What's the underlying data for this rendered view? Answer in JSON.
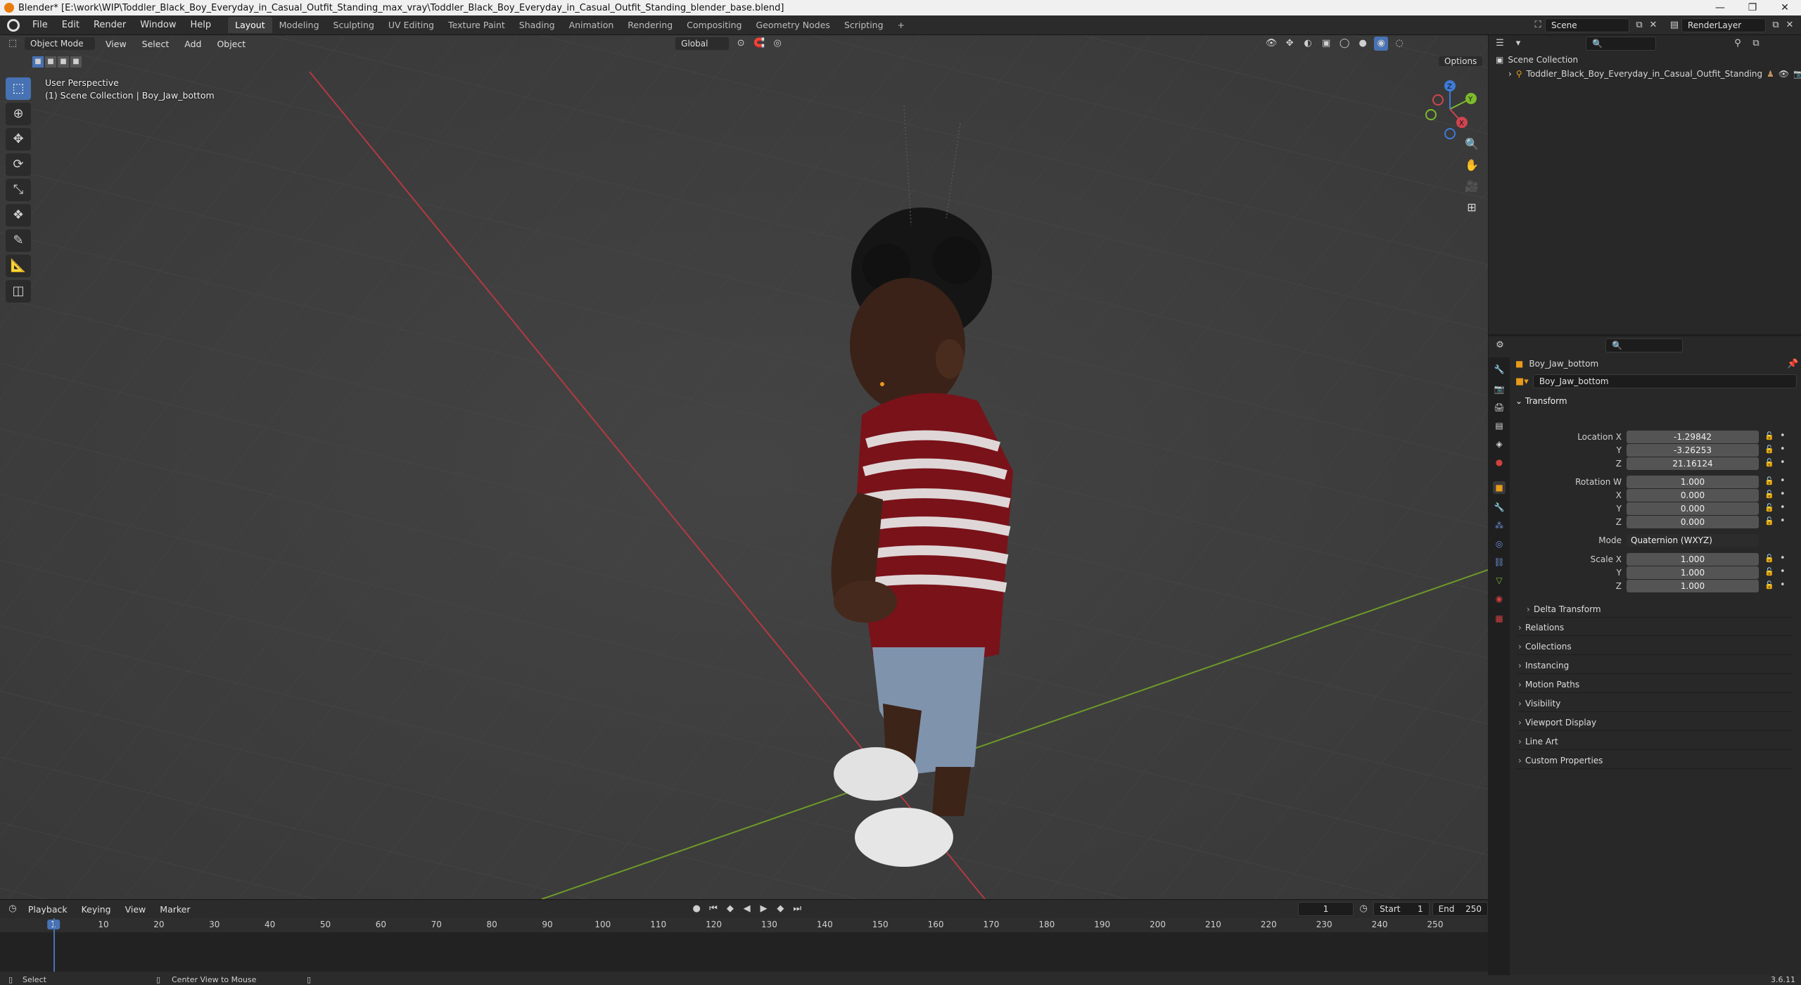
{
  "window": {
    "title": "Blender* [E:\\work\\WIP\\Toddler_Black_Boy_Everyday_in_Casual_Outfit_Standing_max_vray\\Toddler_Black_Boy_Everyday_in_Casual_Outfit_Standing_blender_base.blend]",
    "minimize": "—",
    "maximize": "❐",
    "close": "✕"
  },
  "topbar": {
    "menus": [
      "File",
      "Edit",
      "Render",
      "Window",
      "Help"
    ],
    "workspaces": [
      "Layout",
      "Modeling",
      "Sculpting",
      "UV Editing",
      "Texture Paint",
      "Shading",
      "Animation",
      "Rendering",
      "Compositing",
      "Geometry Nodes",
      "Scripting"
    ],
    "active_workspace": "Layout",
    "add_tab": "+",
    "scene": "Scene",
    "render_layer": "RenderLayer"
  },
  "viewport": {
    "mode": "Object Mode",
    "menus": [
      "View",
      "Select",
      "Add",
      "Object"
    ],
    "orientation": "Global",
    "options": "Options",
    "view_name": "User Perspective",
    "collection_info": "(1) Scene Collection | Boy_Jaw_bottom",
    "gizmo": {
      "x": "X",
      "y": "Y",
      "z": "Z"
    }
  },
  "outliner": {
    "root": "Scene Collection",
    "items": [
      "Toddler_Black_Boy_Everyday_in_Casual_Outfit_Standing"
    ]
  },
  "properties": {
    "object_name": "Boy_Jaw_bottom",
    "data_name": "Boy_Jaw_bottom",
    "transform_label": "Transform",
    "location_label": "Location X",
    "location": [
      "-1.29842",
      "-3.26253",
      "21.16124"
    ],
    "rotation_label": "Rotation W",
    "rotation": [
      "1.000",
      "0.000",
      "0.000",
      "0.000"
    ],
    "mode_label": "Mode",
    "mode_value": "Quaternion (WXYZ)",
    "scale_label": "Scale X",
    "scale": [
      "1.000",
      "1.000",
      "1.000"
    ],
    "axis_labels": [
      "Y",
      "Z",
      "X"
    ],
    "panels": [
      "Delta Transform",
      "Relations",
      "Collections",
      "Instancing",
      "Motion Paths",
      "Visibility",
      "Viewport Display",
      "Line Art",
      "Custom Properties"
    ]
  },
  "timeline": {
    "menus": [
      "Playback",
      "Keying",
      "View",
      "Marker"
    ],
    "current_frame": "1",
    "start_label": "Start",
    "start": "1",
    "end_label": "End",
    "end": "250",
    "ticks": [
      "1",
      "10",
      "20",
      "30",
      "40",
      "50",
      "60",
      "70",
      "80",
      "90",
      "100",
      "110",
      "120",
      "130",
      "140",
      "150",
      "160",
      "170",
      "180",
      "190",
      "200",
      "210",
      "220",
      "230",
      "240",
      "250"
    ]
  },
  "statusbar": {
    "select": "Select",
    "center": "Center View to Mouse",
    "version": "3.6.11"
  },
  "colors": {
    "accent": "#4772b3",
    "x_axis": "#d0444f",
    "y_axis": "#7dbb2b",
    "z_axis": "#3d7bd6",
    "shirt": "#7a1219"
  }
}
